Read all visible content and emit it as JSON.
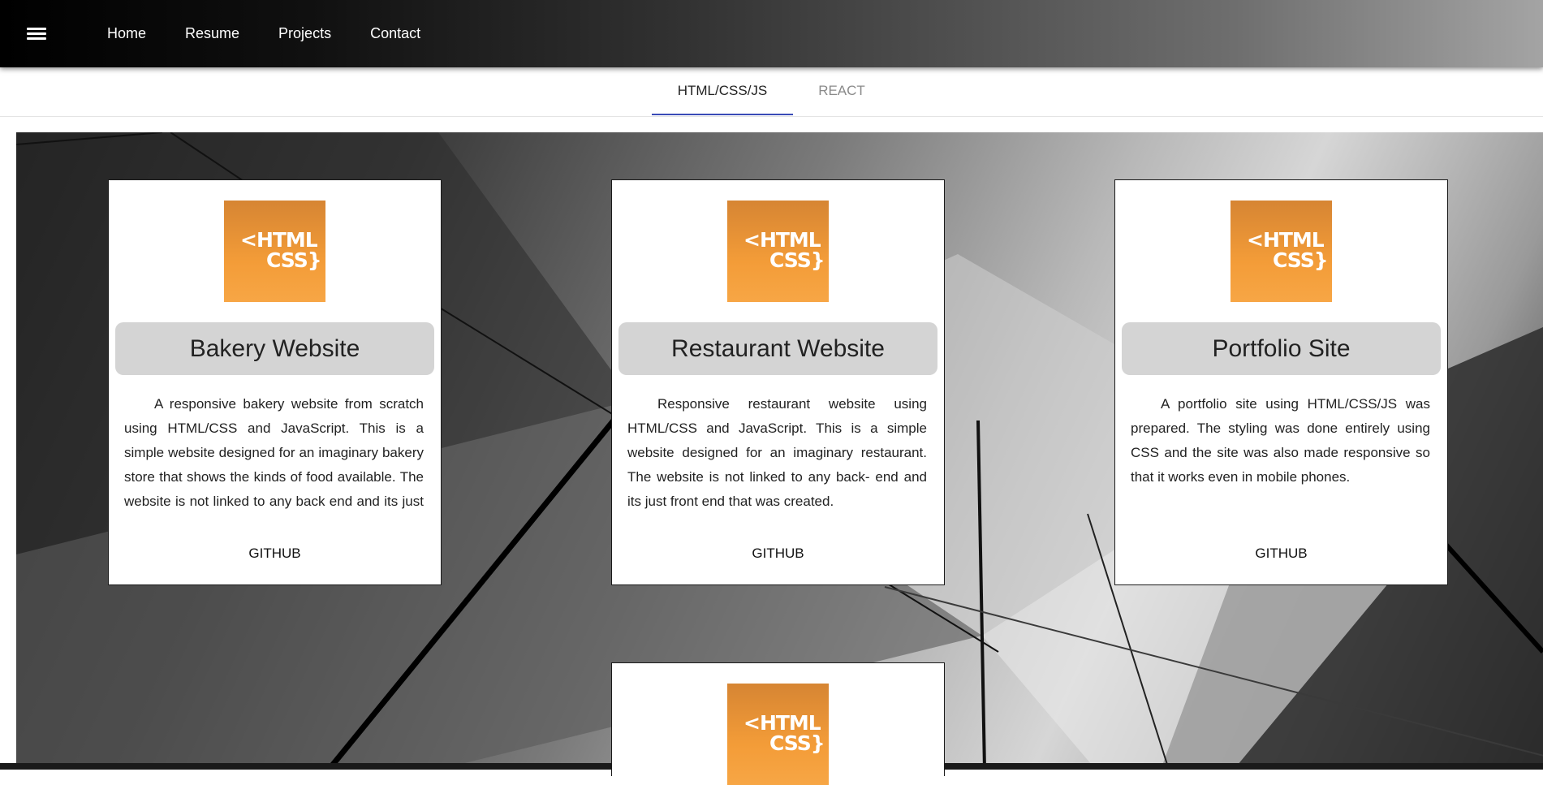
{
  "nav": {
    "menu_icon": "hamburger-menu-icon",
    "links": [
      "Home",
      "Resume",
      "Projects",
      "Contact"
    ]
  },
  "tabs": {
    "active": "HTML/CSS/JS",
    "inactive": "REACT"
  },
  "colors": {
    "tab_indicator": "#3a4bb7",
    "logo_orange": "#f39c38",
    "title_box": "#d4d4d4"
  },
  "projects": [
    {
      "logo_line1": "<HTML",
      "logo_line2": "CSS}",
      "title": "Bakery Website",
      "description": "A responsive bakery website from scratch using HTML/CSS and JavaScript. This is a simple website designed for an imaginary bakery store that shows the kinds of food available. The website is not linked to any back end and its just front end that was created.",
      "link": "GITHUB"
    },
    {
      "logo_line1": "<HTML",
      "logo_line2": "CSS}",
      "title": "Restaurant Website",
      "description": "Responsive restaurant website using HTML/CSS and JavaScript. This is a simple website designed for an imaginary restaurant. The website is not linked to any back- end and its just front end that was created.",
      "link": "GITHUB"
    },
    {
      "logo_line1": "<HTML",
      "logo_line2": "CSS}",
      "title": "Portfolio Site",
      "description": "A portfolio site using HTML/CSS/JS was prepared. The styling was done entirely using CSS and the site was also made responsive so that it works even in mobile phones.",
      "link": "GITHUB"
    },
    {
      "logo_line1": "<HTML",
      "logo_line2": "CSS}"
    }
  ]
}
